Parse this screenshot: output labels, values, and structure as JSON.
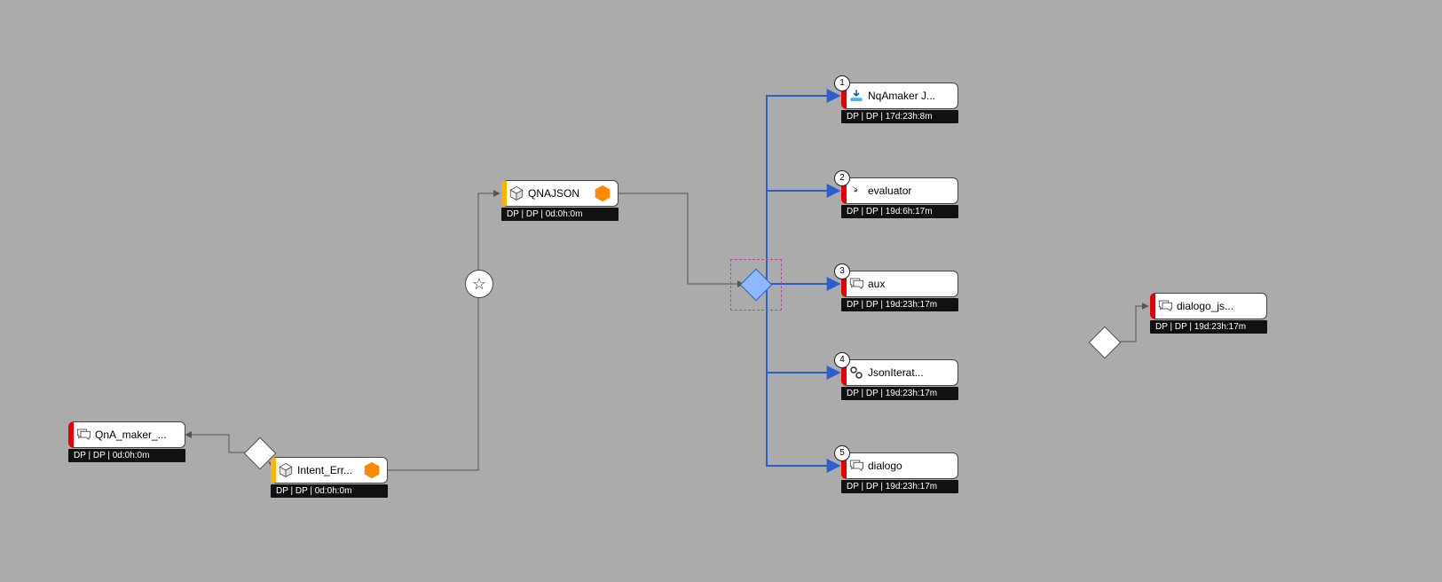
{
  "nodes": {
    "qnajson": {
      "label": "QNAJSON",
      "status": "DP | DP | 0d:0h:0m"
    },
    "intent_err": {
      "label": "Intent_Err...",
      "status": "DP | DP | 0d:0h:0m"
    },
    "qna_maker": {
      "label": "QnA_maker_...",
      "status": "DP | DP | 0d:0h:0m"
    },
    "nqamaker": {
      "label": "NqAmaker J...",
      "status": "DP | DP | 17d:23h:8m",
      "badge": "1"
    },
    "evaluator": {
      "label": "evaluator",
      "status": "DP | DP | 19d:6h:17m",
      "badge": "2"
    },
    "aux": {
      "label": "aux",
      "status": "DP | DP | 19d:23h:17m",
      "badge": "3"
    },
    "jsoniterat": {
      "label": "JsonIterat...",
      "status": "DP | DP | 19d:23h:17m",
      "badge": "4"
    },
    "dialogo": {
      "label": "dialogo",
      "status": "DP | DP | 19d:23h:17m",
      "badge": "5"
    },
    "dialogo_js": {
      "label": "dialogo_js...",
      "status": "DP | DP | 19d:23h:17m"
    }
  },
  "colors": {
    "yellow": "#f7b500",
    "red": "#e60000",
    "blueWire": "#2d5ec9",
    "grayWire": "#555"
  }
}
